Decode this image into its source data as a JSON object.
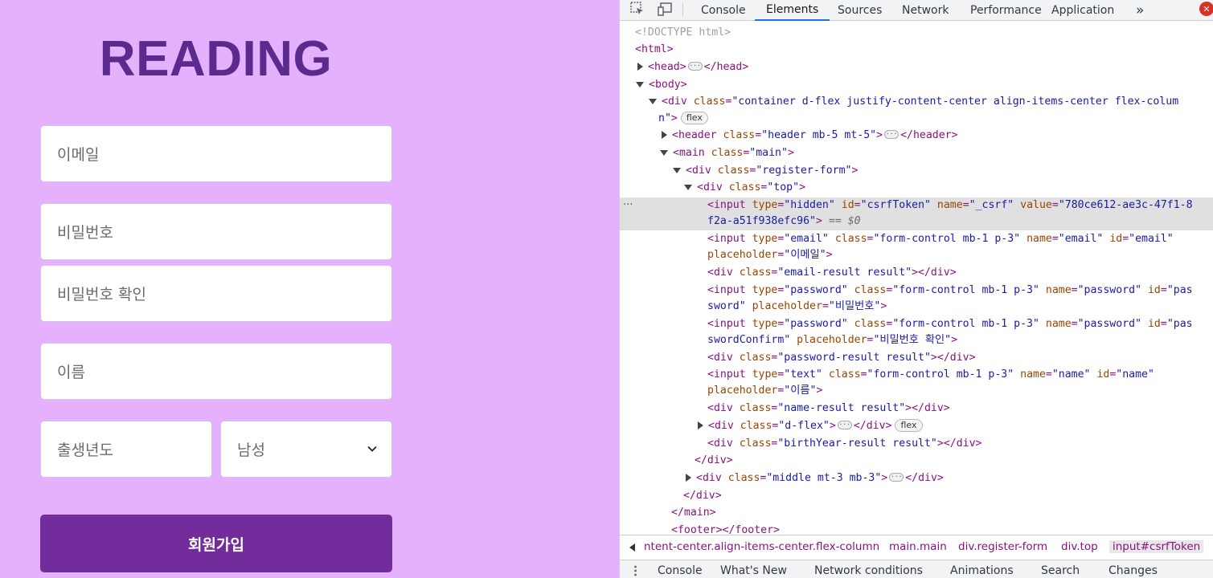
{
  "app": {
    "logo": "READING",
    "fields": {
      "email_placeholder": "이메일",
      "password_placeholder": "비밀번호",
      "password_confirm_placeholder": "비밀번호 확인",
      "name_placeholder": "이름",
      "birth_year_placeholder": "출생년도",
      "gender_selected": "남성"
    },
    "submit_label": "회원가입",
    "colors": {
      "background": "#e5b0fd",
      "logo": "#5c2a8c",
      "button": "#722c9c"
    }
  },
  "devtools": {
    "tabs": [
      "Console",
      "Elements",
      "Sources",
      "Network",
      "Performance",
      "Application"
    ],
    "active_tab": "Elements",
    "more_tabs": "»",
    "error_count": "✕",
    "tree": {
      "doctype": "<!DOCTYPE html>",
      "html_open": "<html>",
      "head_open": "<head>",
      "head_close": "</head>",
      "body_open": "<body>",
      "div_open": "<div ",
      "class_attr": "class",
      "container_class_1": "\"container d-flex justify-content-center align-items-center flex-colum",
      "container_class_2": "n\"",
      "gt": ">",
      "flex_badge": "flex",
      "header_open": "<header ",
      "header_class": "\"header mb-5 mt-5\"",
      "header_close": "</header>",
      "main_open": "<main ",
      "main_class": "\"main\"",
      "register_class": "\"register-form\"",
      "top_class": "\"top\"",
      "input_open": "<input ",
      "type_attr": "type",
      "id_attr": "id",
      "name_attr": "name",
      "value_attr": "value",
      "placeholder_attr": "placeholder",
      "hidden_val": "\"hidden\"",
      "csrf_id": "\"csrfToken\"",
      "csrf_name": "\"_csrf\"",
      "csrf_value_1": "\"780ce612-ae3c-47f1-8",
      "csrf_value_2": "f2a-a51f938efc96\"",
      "eq_dollar": "== $0",
      "email_type": "\"email\"",
      "form_class": "\"form-control mb-1 p-3\"",
      "email_name": "\"email\"",
      "email_id": "\"email\"",
      "email_ph": "\"이메일\"",
      "email_result_class": "\"email-result result\"",
      "div_close": "</div>",
      "password_type": "\"password\"",
      "password_name": "\"password\"",
      "pas_1": "\"pas",
      "password_id_2": "sword\"",
      "password_ph": "\"비밀번호\"",
      "password_confirm_id_2": "swordConfirm\"",
      "password_confirm_ph": "\"비밀번호 확인\"",
      "password_result_class": "\"password-result result\"",
      "text_type": "\"text\"",
      "name_name": "\"name\"",
      "name_id": "\"name\"",
      "name_ph": "\"이름\"",
      "name_result_class": "\"name-result result\"",
      "dflex_class": "\"d-flex\"",
      "birth_result_class": "\"birthYear-result result\"",
      "middle_class": "\"middle mt-3 mb-3\"",
      "main_close": "</main>",
      "footer": "<footer></footer>",
      "eq": "=",
      "space": " "
    },
    "breadcrumbs": [
      "ntent-center.align-items-center.flex-column",
      "main.main",
      "div.register-form",
      "div.top",
      "input#csrfToken"
    ],
    "drawer_tabs": [
      "Console",
      "What's New",
      "Network conditions",
      "Animations",
      "Search",
      "Changes"
    ]
  }
}
